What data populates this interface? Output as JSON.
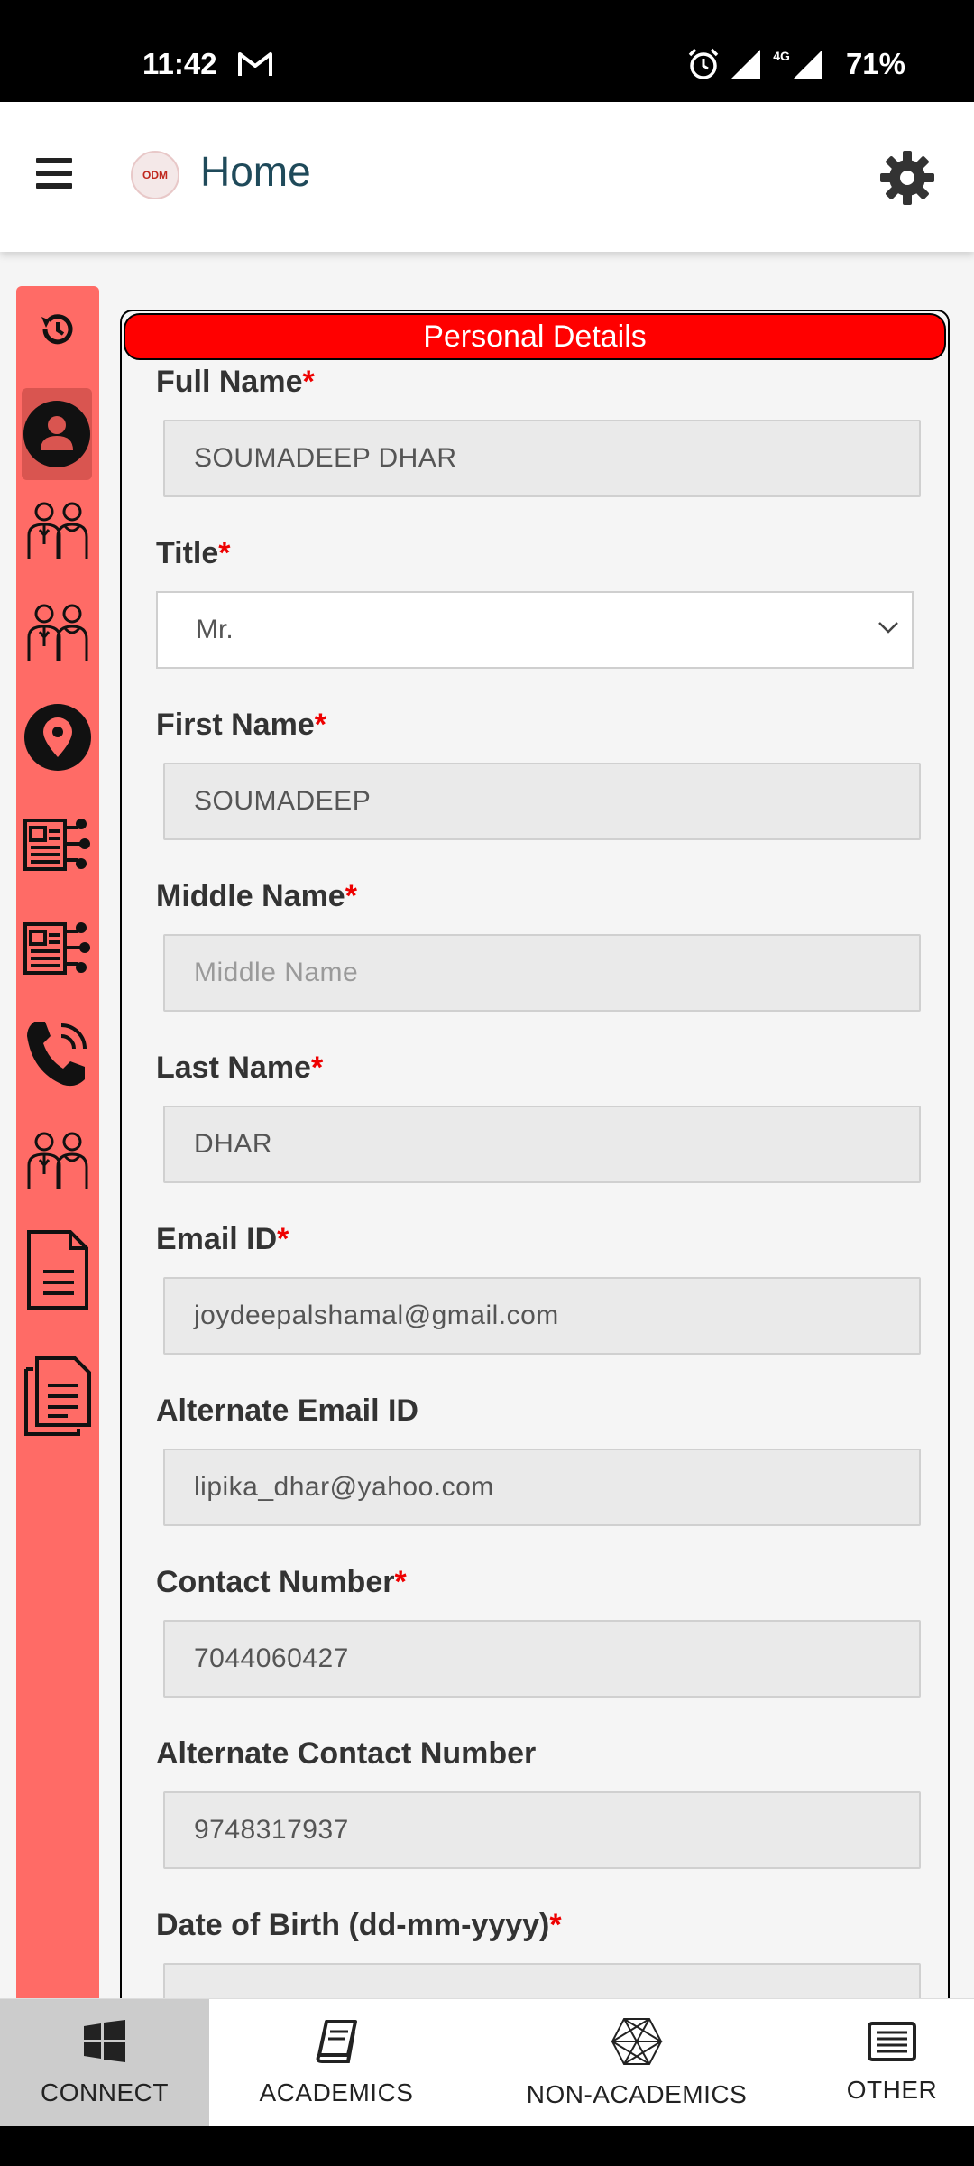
{
  "status_bar": {
    "time": "11:42",
    "network": "4G",
    "battery": "71%"
  },
  "header": {
    "title": "Home",
    "logo_text": "ODM"
  },
  "section": {
    "title": "Personal Details"
  },
  "form": {
    "full_name": {
      "label": "Full Name",
      "required": "*",
      "value": "SOUMADEEP  DHAR"
    },
    "title": {
      "label": "Title",
      "required": "*",
      "value": "Mr."
    },
    "first_name": {
      "label": "First Name",
      "required": "*",
      "value": "SOUMADEEP"
    },
    "middle_name": {
      "label": "Middle Name",
      "required": "*",
      "placeholder": "Middle Name"
    },
    "last_name": {
      "label": "Last Name",
      "required": "*",
      "value": "DHAR"
    },
    "email": {
      "label": "Email ID",
      "required": "*",
      "value": "joydeepalshamal@gmail.com"
    },
    "alt_email": {
      "label": "Alternate Email ID",
      "value": "lipika_dhar@yahoo.com"
    },
    "contact": {
      "label": "Contact Number",
      "required": "*",
      "value": "7044060427"
    },
    "alt_contact": {
      "label": "Alternate Contact Number",
      "value": "9748317937"
    },
    "dob": {
      "label": "Date of Birth (dd-mm-yyyy)",
      "required": "*",
      "value": ""
    }
  },
  "sidebar": {
    "items": [
      "history-icon",
      "profile-icon",
      "family-icon",
      "guardian-icon",
      "location-icon",
      "id-card-icon",
      "id-card-alt-icon",
      "phone-icon",
      "contacts-group-icon",
      "document-icon",
      "documents-icon"
    ],
    "active_index": 1
  },
  "bottom_nav": {
    "items": [
      {
        "label": "CONNECT",
        "icon": "windows-icon"
      },
      {
        "label": "ACADEMICS",
        "icon": "book-icon"
      },
      {
        "label": "NON-ACADEMICS",
        "icon": "hexagon-mesh-icon"
      },
      {
        "label": "OTHER",
        "icon": "list-icon"
      }
    ],
    "active": "CONNECT"
  },
  "colors": {
    "accent_red": "#ff0000",
    "sidebar_bg": "#ff6b66",
    "title_teal": "#1f4a5a"
  }
}
